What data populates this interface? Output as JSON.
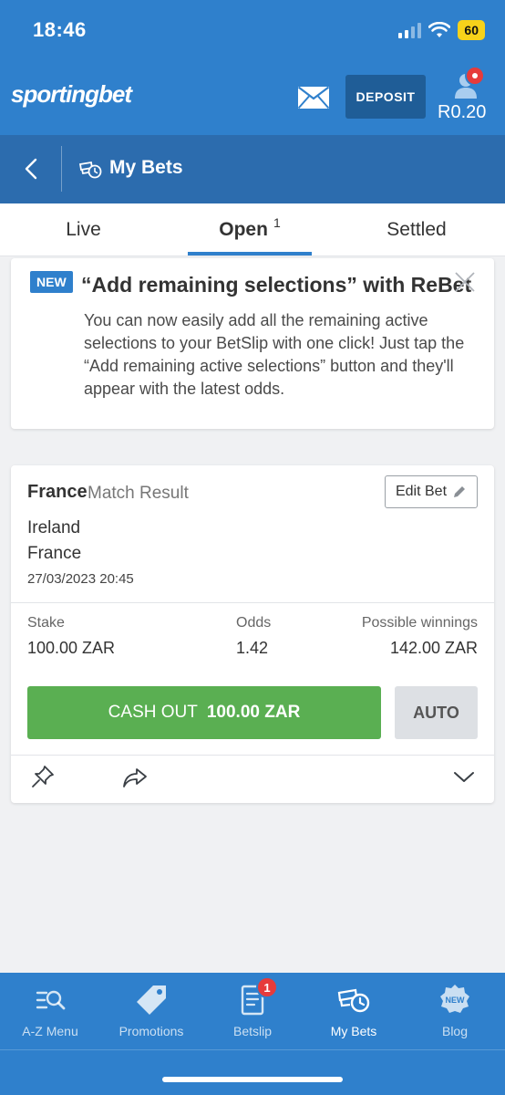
{
  "status_bar": {
    "time": "18:46",
    "battery": "60"
  },
  "header": {
    "brand": "sportingbet",
    "deposit_label": "DEPOSIT",
    "balance": "R0.20"
  },
  "subheader": {
    "title": "My Bets"
  },
  "tabs": [
    {
      "label": "Live"
    },
    {
      "label": "Open",
      "count": "1"
    },
    {
      "label": "Settled"
    }
  ],
  "promo": {
    "badge": "NEW",
    "title": "“Add remaining selections” with ReBet",
    "text": "You can now easily add all the remaining active selections to your BetSlip with one click! Just tap the “Add remaining active selections” button and they'll appear with the latest odds."
  },
  "bet": {
    "selection": "France",
    "market": "Match Result",
    "edit_label": "Edit Bet",
    "team1": "Ireland",
    "team2": "France",
    "datetime": "27/03/2023 20:45",
    "stake_label": "Stake",
    "stake_value": "100.00 ZAR",
    "odds_label": "Odds",
    "odds_value": "1.42",
    "winnings_label": "Possible winnings",
    "winnings_value": "142.00 ZAR",
    "cashout_label": "CASH OUT",
    "cashout_amount": "100.00 ZAR",
    "auto_label": "AUTO"
  },
  "bottom_nav": [
    {
      "label": "A-Z Menu",
      "icon": "az-menu-icon"
    },
    {
      "label": "Promotions",
      "icon": "tag-icon"
    },
    {
      "label": "Betslip",
      "icon": "betslip-icon",
      "badge": "1"
    },
    {
      "label": "My Bets",
      "icon": "mybets-icon",
      "active": true
    },
    {
      "label": "Blog",
      "icon": "blog-icon",
      "badge_text": "NEW"
    }
  ],
  "colors": {
    "primary": "#2f80cc",
    "header_dark": "#2c6cae",
    "cashout_green": "#5aaf52",
    "badge_red": "#e63b3b"
  }
}
